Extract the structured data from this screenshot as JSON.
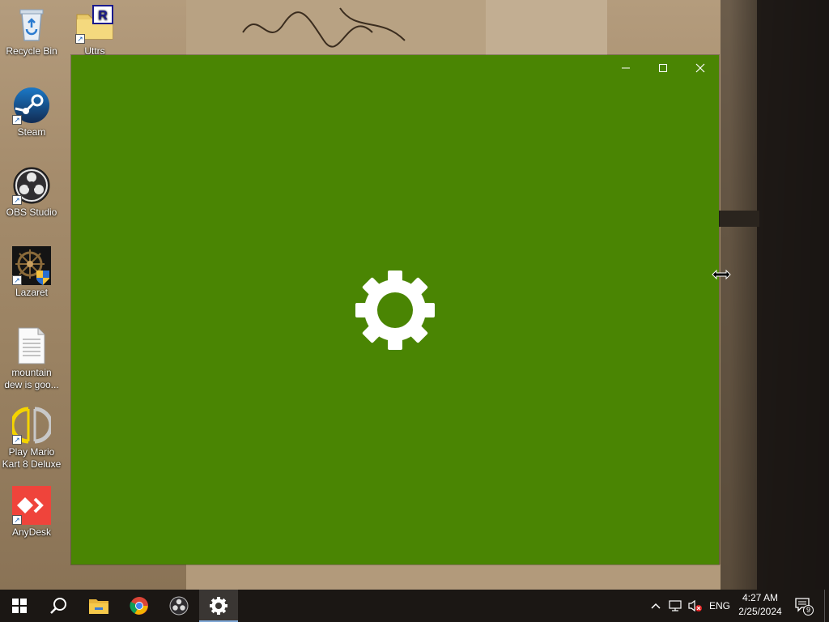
{
  "desktop": {
    "icons": [
      {
        "label": "Recycle Bin",
        "icon": "recycle-bin-icon"
      },
      {
        "label": "Uttrs",
        "icon": "folder-icon"
      },
      {
        "label": "Steam",
        "icon": "steam-icon"
      },
      {
        "label": "OBS Studio",
        "icon": "obs-icon"
      },
      {
        "label": "Lazaret",
        "icon": "lazaret-icon"
      },
      {
        "label": "mountain dew is goo...",
        "icon": "text-file-icon"
      },
      {
        "label": "Play Mario Kart 8 Deluxe",
        "icon": "yuzu-icon"
      },
      {
        "label": "AnyDesk",
        "icon": "anydesk-icon"
      }
    ]
  },
  "window": {
    "background_color": "#4a8503",
    "splash_icon": "gear-icon"
  },
  "taskbar": {
    "apps": [
      {
        "icon": "windows-start-icon"
      },
      {
        "icon": "search-icon"
      },
      {
        "icon": "file-explorer-icon"
      },
      {
        "icon": "chrome-icon"
      },
      {
        "icon": "obs-icon"
      },
      {
        "icon": "settings-gear-icon"
      }
    ],
    "tray": {
      "language": "ENG",
      "time": "4:27 AM",
      "date": "2/25/2024",
      "notification_count": "9"
    }
  },
  "colors": {
    "accent": "#4a8503",
    "taskbar": "#1b1714"
  }
}
